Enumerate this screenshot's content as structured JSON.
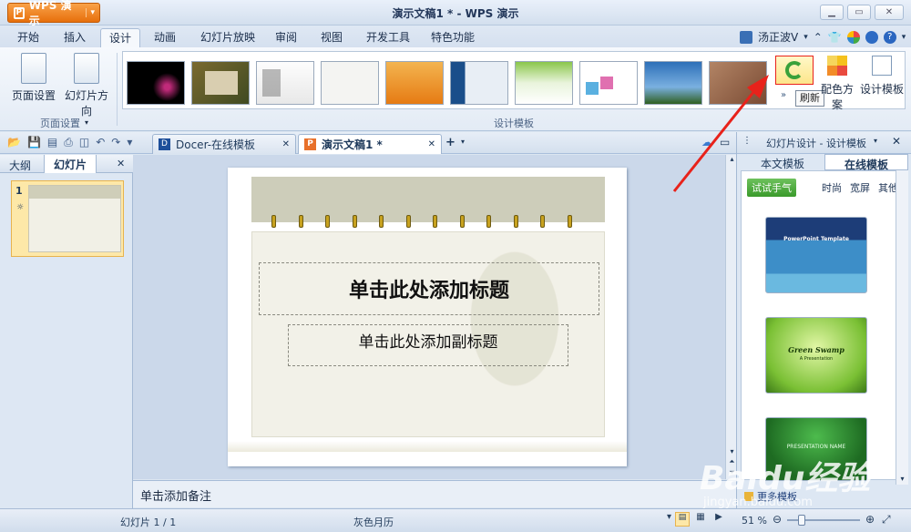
{
  "app": {
    "button_label": "WPS 演示",
    "window_title": "演示文稿1 * - WPS 演示"
  },
  "menu": [
    "开始",
    "插入",
    "设计",
    "动画",
    "幻灯片放映",
    "审阅",
    "视图",
    "开发工具",
    "特色功能"
  ],
  "user": {
    "name": "汤正波V"
  },
  "ribbon": {
    "page_setup": "页面设置",
    "slide_orientation": "幻灯片方向",
    "page_setup_group": "页面设置",
    "design_templates_group": "设计模板",
    "color_scheme": "配色方案",
    "design_template": "设计模板",
    "refresh_tooltip": "刷新"
  },
  "tabs": {
    "docer": "Docer-在线模板",
    "document": "演示文稿1 *"
  },
  "left_panel": {
    "tab_outline": "大纲",
    "tab_slides": "幻灯片",
    "slide_number": "1"
  },
  "slide": {
    "title_placeholder": "单击此处添加标题",
    "subtitle_placeholder": "单击此处添加副标题"
  },
  "notes": {
    "placeholder": "单击添加备注"
  },
  "right_panel": {
    "title": "幻灯片设计 - 设计模板",
    "tab_this_doc": "本文模板",
    "tab_online": "在线模板",
    "try_luck": "试试手气",
    "filter_fashion": "时尚",
    "filter_widescreen": "宽屏",
    "filter_other": "其他",
    "template1_title": "PowerPoint Template",
    "template2_title": "Green Swamp",
    "template2_sub": "A Presentation",
    "template3_title": "PRESENTATION NAME",
    "more_templates": "更多模板"
  },
  "status": {
    "slide_position": "幻灯片 1 / 1",
    "theme_name": "灰色月历",
    "zoom": "51 %"
  },
  "watermark": {
    "brand": "Baidu经验",
    "url": "jingyan.baidu.com"
  },
  "colors": {
    "accent_orange": "#f08a24",
    "annotation_red": "#e8221b",
    "refresh_green": "#3aa13a"
  }
}
